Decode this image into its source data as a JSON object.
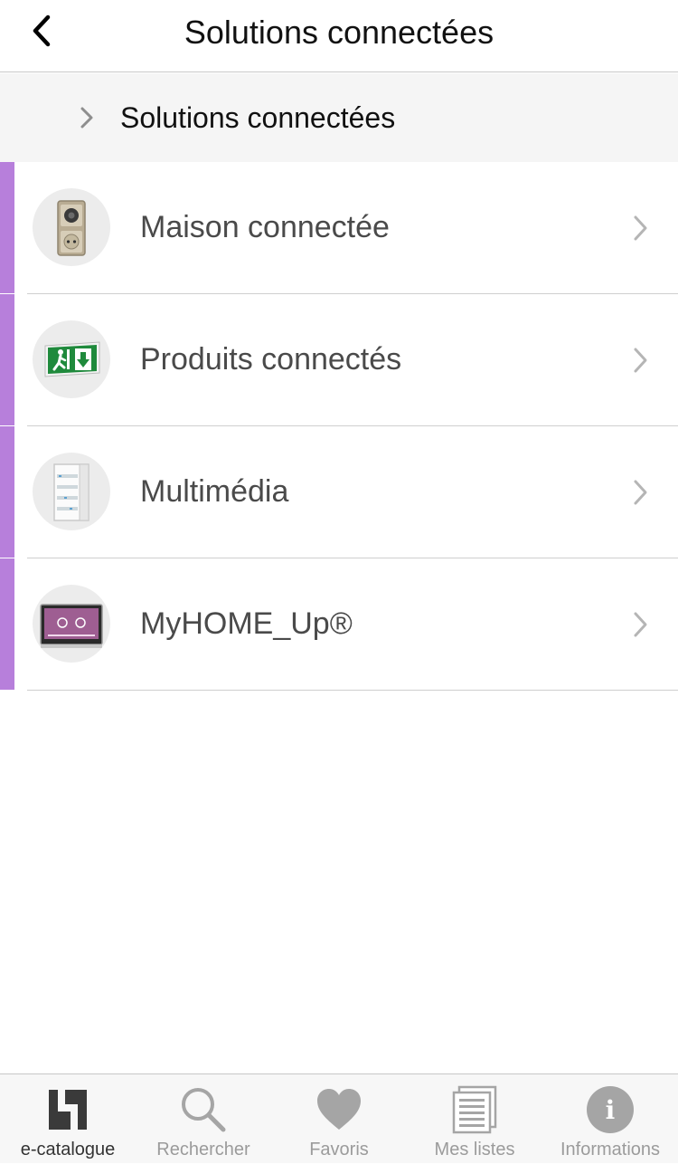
{
  "header": {
    "title": "Solutions connectées"
  },
  "breadcrumb": {
    "items": [
      "Solutions connectées"
    ]
  },
  "list": {
    "accent_color": "#b77fdb",
    "items": [
      {
        "label": "Maison connectée",
        "icon": "wall-switch-outlet-icon"
      },
      {
        "label": "Produits connectés",
        "icon": "emergency-exit-sign-icon"
      },
      {
        "label": "Multimédia",
        "icon": "electrical-cabinet-icon"
      },
      {
        "label": "MyHOME_Up®",
        "icon": "touch-screen-panel-icon"
      }
    ]
  },
  "tabs": [
    {
      "label": "e-catalogue",
      "icon": "e-catalogue-icon",
      "active": true
    },
    {
      "label": "Rechercher",
      "icon": "search-icon",
      "active": false
    },
    {
      "label": "Favoris",
      "icon": "heart-icon",
      "active": false
    },
    {
      "label": "Mes listes",
      "icon": "list-document-icon",
      "active": false
    },
    {
      "label": "Informations",
      "icon": "info-icon",
      "active": false
    }
  ]
}
